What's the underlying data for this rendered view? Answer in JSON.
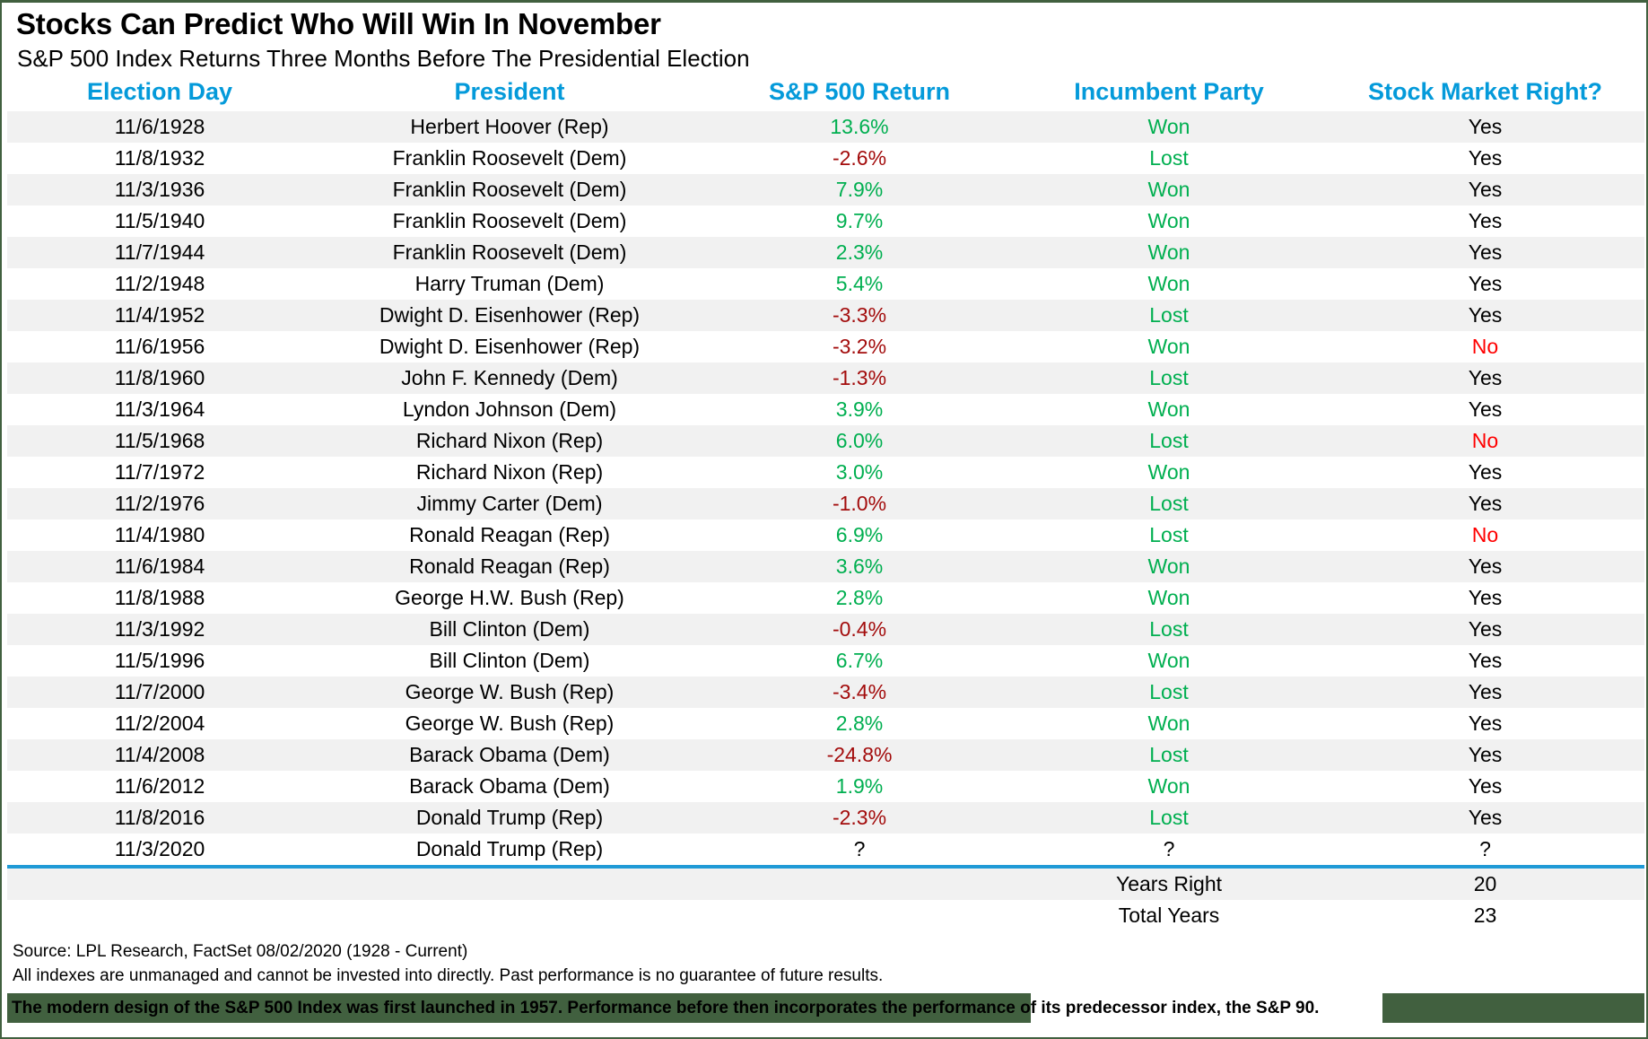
{
  "header": {
    "title": "Stocks Can Predict Who Will Win In November",
    "subtitle": "S&P 500 Index Returns Three Months Before The Presidential Election"
  },
  "colors": {
    "header_blue": "#049ada",
    "positive_green": "#00af50",
    "negative_red": "#a30c0c",
    "no_red": "#ff0000",
    "separator_blue": "#1f9ad6",
    "band_green": "#41603f",
    "stripe_gray": "#f1f1f1"
  },
  "table": {
    "columns": [
      "Election Day",
      "President",
      "S&P 500 Return",
      "Incumbent Party",
      "Stock Market Right?"
    ],
    "rows": [
      {
        "date": "11/6/1928",
        "president": "Herbert Hoover (Rep)",
        "return": "13.6%",
        "return_value": 13.6,
        "party": "Won",
        "right": "Yes"
      },
      {
        "date": "11/8/1932",
        "president": "Franklin Roosevelt (Dem)",
        "return": "-2.6%",
        "return_value": -2.6,
        "party": "Lost",
        "right": "Yes"
      },
      {
        "date": "11/3/1936",
        "president": "Franklin Roosevelt (Dem)",
        "return": "7.9%",
        "return_value": 7.9,
        "party": "Won",
        "right": "Yes"
      },
      {
        "date": "11/5/1940",
        "president": "Franklin Roosevelt (Dem)",
        "return": "9.7%",
        "return_value": 9.7,
        "party": "Won",
        "right": "Yes"
      },
      {
        "date": "11/7/1944",
        "president": "Franklin Roosevelt (Dem)",
        "return": "2.3%",
        "return_value": 2.3,
        "party": "Won",
        "right": "Yes"
      },
      {
        "date": "11/2/1948",
        "president": "Harry Truman (Dem)",
        "return": "5.4%",
        "return_value": 5.4,
        "party": "Won",
        "right": "Yes"
      },
      {
        "date": "11/4/1952",
        "president": "Dwight D. Eisenhower (Rep)",
        "return": "-3.3%",
        "return_value": -3.3,
        "party": "Lost",
        "right": "Yes"
      },
      {
        "date": "11/6/1956",
        "president": "Dwight D. Eisenhower (Rep)",
        "return": "-3.2%",
        "return_value": -3.2,
        "party": "Won",
        "right": "No"
      },
      {
        "date": "11/8/1960",
        "president": "John F. Kennedy (Dem)",
        "return": "-1.3%",
        "return_value": -1.3,
        "party": "Lost",
        "right": "Yes"
      },
      {
        "date": "11/3/1964",
        "president": "Lyndon Johnson (Dem)",
        "return": "3.9%",
        "return_value": 3.9,
        "party": "Won",
        "right": "Yes"
      },
      {
        "date": "11/5/1968",
        "president": "Richard Nixon (Rep)",
        "return": "6.0%",
        "return_value": 6.0,
        "party": "Lost",
        "right": "No"
      },
      {
        "date": "11/7/1972",
        "president": "Richard Nixon (Rep)",
        "return": "3.0%",
        "return_value": 3.0,
        "party": "Won",
        "right": "Yes"
      },
      {
        "date": "11/2/1976",
        "president": "Jimmy Carter (Dem)",
        "return": "-1.0%",
        "return_value": -1.0,
        "party": "Lost",
        "right": "Yes"
      },
      {
        "date": "11/4/1980",
        "president": "Ronald Reagan (Rep)",
        "return": "6.9%",
        "return_value": 6.9,
        "party": "Lost",
        "right": "No"
      },
      {
        "date": "11/6/1984",
        "president": "Ronald Reagan (Rep)",
        "return": "3.6%",
        "return_value": 3.6,
        "party": "Won",
        "right": "Yes"
      },
      {
        "date": "11/8/1988",
        "president": "George H.W. Bush (Rep)",
        "return": "2.8%",
        "return_value": 2.8,
        "party": "Won",
        "right": "Yes"
      },
      {
        "date": "11/3/1992",
        "president": "Bill Clinton (Dem)",
        "return": "-0.4%",
        "return_value": -0.4,
        "party": "Lost",
        "right": "Yes"
      },
      {
        "date": "11/5/1996",
        "president": "Bill Clinton (Dem)",
        "return": "6.7%",
        "return_value": 6.7,
        "party": "Won",
        "right": "Yes"
      },
      {
        "date": "11/7/2000",
        "president": "George W. Bush (Rep)",
        "return": "-3.4%",
        "return_value": -3.4,
        "party": "Lost",
        "right": "Yes"
      },
      {
        "date": "11/2/2004",
        "president": "George W. Bush (Rep)",
        "return": "2.8%",
        "return_value": 2.8,
        "party": "Won",
        "right": "Yes"
      },
      {
        "date": "11/4/2008",
        "president": "Barack Obama (Dem)",
        "return": "-24.8%",
        "return_value": -24.8,
        "party": "Lost",
        "right": "Yes"
      },
      {
        "date": "11/6/2012",
        "president": "Barack Obama (Dem)",
        "return": "1.9%",
        "return_value": 1.9,
        "party": "Won",
        "right": "Yes"
      },
      {
        "date": "11/8/2016",
        "president": "Donald Trump (Rep)",
        "return": "-2.3%",
        "return_value": -2.3,
        "party": "Lost",
        "right": "Yes"
      },
      {
        "date": "11/3/2020",
        "president": "Donald Trump (Rep)",
        "return": "?",
        "return_value": null,
        "party": "?",
        "right": "?"
      }
    ]
  },
  "summary": {
    "rows": [
      {
        "label": "Years Right",
        "value": "20"
      },
      {
        "label": "Total Years",
        "value": "23"
      }
    ]
  },
  "footer": {
    "source": "Source: LPL Research, FactSet 08/02/2020 (1928 - Current)",
    "disclaimer": "All indexes are unmanaged and cannot be invested into directly. Past performance is no guarantee of future results.",
    "band_note": "The modern design of the S&P 500 Index was first launched in 1957. Performance before then incorporates the performance of its  predecessor index, the S&P 90."
  },
  "chart_data": {
    "type": "table",
    "title": "Stocks Can Predict Who Will Win In November",
    "subtitle": "S&P 500 Index Returns Three Months Before The Presidential Election",
    "columns": [
      "Election Day",
      "President",
      "S&P 500 Return",
      "Incumbent Party",
      "Stock Market Right?"
    ],
    "categories": [
      "11/6/1928",
      "11/8/1932",
      "11/3/1936",
      "11/5/1940",
      "11/7/1944",
      "11/2/1948",
      "11/4/1952",
      "11/6/1956",
      "11/8/1960",
      "11/3/1964",
      "11/5/1968",
      "11/7/1972",
      "11/2/1976",
      "11/4/1980",
      "11/6/1984",
      "11/8/1988",
      "11/3/1992",
      "11/5/1996",
      "11/7/2000",
      "11/2/2004",
      "11/4/2008",
      "11/6/2012",
      "11/8/2016",
      "11/3/2020"
    ],
    "series": [
      {
        "name": "S&P 500 Return (3 months before election, %)",
        "values": [
          13.6,
          -2.6,
          7.9,
          9.7,
          2.3,
          5.4,
          -3.3,
          -3.2,
          -1.3,
          3.9,
          6.0,
          3.0,
          -1.0,
          6.9,
          3.6,
          2.8,
          -0.4,
          6.7,
          -3.4,
          2.8,
          -24.8,
          1.9,
          -2.3,
          null
        ]
      },
      {
        "name": "Incumbent Party",
        "values": [
          "Won",
          "Lost",
          "Won",
          "Won",
          "Won",
          "Won",
          "Lost",
          "Won",
          "Lost",
          "Won",
          "Lost",
          "Won",
          "Lost",
          "Lost",
          "Won",
          "Won",
          "Lost",
          "Won",
          "Lost",
          "Won",
          "Lost",
          "Won",
          "Lost",
          "?"
        ]
      },
      {
        "name": "Stock Market Right?",
        "values": [
          "Yes",
          "Yes",
          "Yes",
          "Yes",
          "Yes",
          "Yes",
          "Yes",
          "No",
          "Yes",
          "Yes",
          "No",
          "Yes",
          "Yes",
          "No",
          "Yes",
          "Yes",
          "Yes",
          "Yes",
          "Yes",
          "Yes",
          "Yes",
          "Yes",
          "Yes",
          "?"
        ]
      }
    ],
    "totals": {
      "years_right": 20,
      "total_years": 23
    },
    "xlabel": "Election Day",
    "ylabel": "S&P 500 Return",
    "grid": false,
    "legend": "none"
  }
}
